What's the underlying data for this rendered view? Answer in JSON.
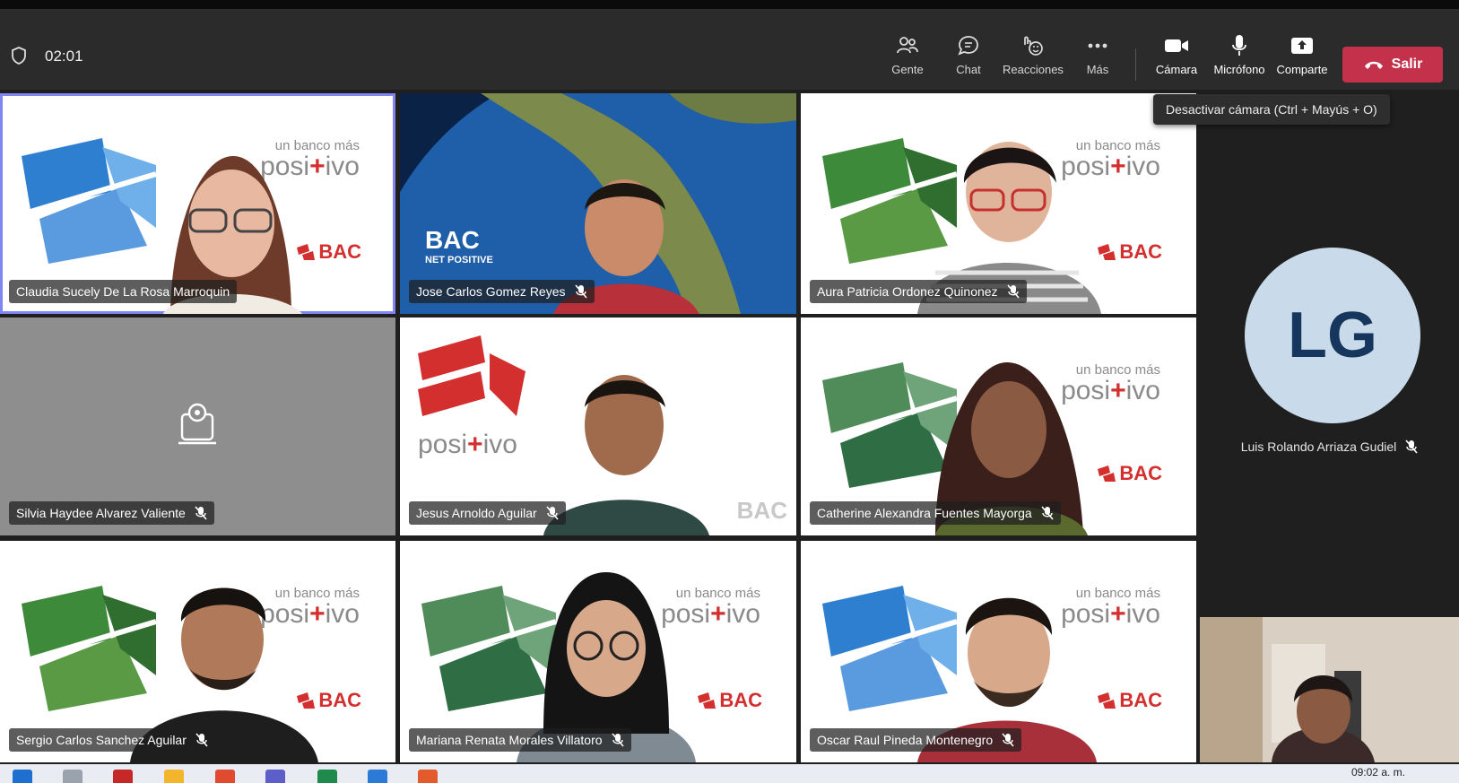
{
  "meeting": {
    "timer": "02:01"
  },
  "toolbar": {
    "people_label": "Gente",
    "chat_label": "Chat",
    "reactions_label": "Reacciones",
    "more_label": "Más",
    "camera_label": "Cámara",
    "mic_label": "Micrófono",
    "share_label": "Comparte",
    "leave_label": "Salir",
    "camera_tooltip": "Desactivar cámara (Ctrl + Mayús + O)"
  },
  "branding": {
    "slogan_top": "un banco más",
    "slogan_bottom_pre": "posi",
    "slogan_bottom_plus": "+",
    "slogan_bottom_post": "ivo",
    "bac": "BAC",
    "bac_net_positive_1": "BAC",
    "bac_net_positive_2": "NET POSITIVE"
  },
  "participants": [
    {
      "name": "Claudia Sucely De La Rosa Marroquin",
      "muted": false,
      "active": true
    },
    {
      "name": "Jose Carlos Gomez Reyes",
      "muted": true
    },
    {
      "name": "Aura Patricia Ordonez Quinonez",
      "muted": true
    },
    {
      "name": "Silvia Haydee Alvarez Valiente",
      "muted": true,
      "camera_off": true
    },
    {
      "name": "Jesus Arnoldo Aguilar",
      "muted": true
    },
    {
      "name": "Catherine Alexandra Fuentes Mayorga",
      "muted": true
    },
    {
      "name": "Sergio Carlos Sanchez Aguilar",
      "muted": true
    },
    {
      "name": "Mariana Renata Morales Villatoro",
      "muted": true
    },
    {
      "name": "Oscar Raul Pineda Montenegro",
      "muted": true
    }
  ],
  "side_participant": {
    "initials": "LG",
    "name": "Luis Rolando Arriaza Gudiel",
    "muted": true
  },
  "taskbar": {
    "time": "09:02 a. m."
  },
  "colors": {
    "leave": "#c4314b",
    "active_speaker": "#7f85f5",
    "brand_red": "#d32f2f",
    "avatar_bg": "#c9dbea"
  }
}
